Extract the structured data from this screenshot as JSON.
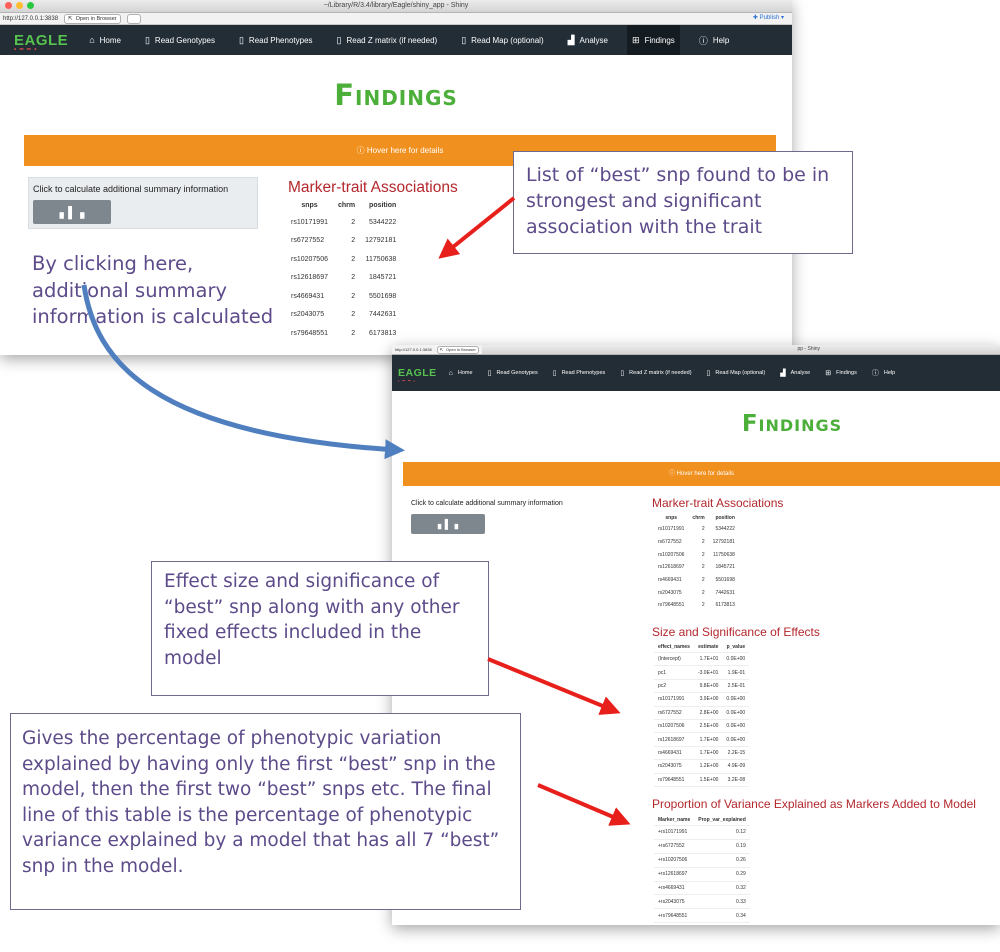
{
  "window1": {
    "titlebar": "~/Library/R/3.4/library/Eagle/shiny_app - Shiny",
    "url": "http://127.0.0.1:3838",
    "open_in_browser": "Open in Browser",
    "publish": "Publish",
    "logo": "EAGLE",
    "nav": {
      "home": "Home",
      "read_genotypes": "Read Genotypes",
      "read_phenotypes": "Read Phenotypes",
      "read_z": "Read Z matrix (if needed)",
      "read_map": "Read Map (optional)",
      "analyse": "Analyse",
      "findings": "Findings",
      "help": "Help"
    },
    "page_title": "Findings",
    "hover_text": "Hover here for details",
    "calc_text": "Click to calculate additional summary information",
    "assoc_title": "Marker-trait Associations",
    "assoc_headers": [
      "snps",
      "chrm",
      "position"
    ],
    "assoc_rows": [
      [
        "rs10171991",
        "2",
        "5344222"
      ],
      [
        "rs6727552",
        "2",
        "12792181"
      ],
      [
        "rs10207506",
        "2",
        "11750638"
      ],
      [
        "rs12618697",
        "2",
        "1845721"
      ],
      [
        "rs4669431",
        "2",
        "5501698"
      ],
      [
        "rs2043075",
        "2",
        "7442631"
      ],
      [
        "rs79648551",
        "2",
        "6173813"
      ]
    ]
  },
  "window2": {
    "titlebar": "pp - Shiny",
    "url": "http://127.0.0.1:3838",
    "open_in_browser": "Open in Browser",
    "logo": "EAGLE",
    "nav": {
      "home": "Home",
      "read_genotypes": "Read Genotypes",
      "read_phenotypes": "Read Phenotypes",
      "read_z": "Read Z matrix (if needed)",
      "read_map": "Read Map (optional)",
      "analyse": "Analyse",
      "findings": "Findings",
      "help": "Help"
    },
    "page_title": "Findings",
    "hover_text": "Hover here for details",
    "calc_text": "Click to calculate additional summary information",
    "assoc_title": "Marker-trait Associations",
    "assoc_headers": [
      "snps",
      "chrm",
      "position"
    ],
    "assoc_rows": [
      [
        "rs10171991",
        "2",
        "5344222"
      ],
      [
        "rs6727552",
        "2",
        "12792181"
      ],
      [
        "rs10207506",
        "2",
        "11750638"
      ],
      [
        "rs12618697",
        "2",
        "1845721"
      ],
      [
        "rs4669431",
        "2",
        "5501698"
      ],
      [
        "rs2043075",
        "2",
        "7442631"
      ],
      [
        "rs79648551",
        "2",
        "6173813"
      ]
    ],
    "effects_title": "Size and Significance of Effects",
    "effects_headers": [
      "effect_names",
      "estimate",
      "p_value"
    ],
    "effects_rows": [
      [
        "(Intercept)",
        "1.7E+01",
        "0.0E+00"
      ],
      [
        "pc1",
        "-3.0E+01",
        "1.9E-01"
      ],
      [
        "pc2",
        "9.8E+00",
        "2.5E-01"
      ],
      [
        "rs10171991",
        "3.9E+00",
        "0.0E+00"
      ],
      [
        "rs6727552",
        "2.8E+00",
        "0.0E+00"
      ],
      [
        "rs10207506",
        "2.5E+00",
        "0.0E+00"
      ],
      [
        "rs12618697",
        "1.7E+00",
        "0.0E+00"
      ],
      [
        "rs4669431",
        "1.7E+00",
        "2.2E-15"
      ],
      [
        "rs2043075",
        "1.2E+00",
        "4.9E-09"
      ],
      [
        "rs79648551",
        "1.5E+00",
        "3.2E-08"
      ]
    ],
    "variance_title": "Proportion of Variance Explained as Markers Added to Model",
    "variance_headers": [
      "Marker_name",
      "Prop_var_explained"
    ],
    "variance_rows": [
      [
        "+rs10171991",
        "0.12"
      ],
      [
        "+rs6727552",
        "0.19"
      ],
      [
        "+rs10207506",
        "0.26"
      ],
      [
        "+rs12618697",
        "0.29"
      ],
      [
        "+rs4669431",
        "0.32"
      ],
      [
        "+rs2043075",
        "0.33"
      ],
      [
        "+rs79648551",
        "0.34"
      ]
    ]
  },
  "annotations": {
    "best_snp_list": "List of “best” snp found to be in strongest and significant association with the trait",
    "click_here": "By clicking here, additional summary information is calculated",
    "effect_size": "Effect size and significance of “best” snp along with any other fixed effects included in the model",
    "variance": "Gives the percentage of phenotypic variation explained by having only the first “best” snp in the model, then the first two “best” snps etc. The final line of this table is  the percentage of phenotypic variance explained by a model that has all 7 “best” snp in the model."
  },
  "colors": {
    "navbar": "#222d36",
    "brand_green": "#4caf3a",
    "hover_bar": "#f0901e",
    "section_title": "#b3282d",
    "annotation_text": "#5d4b8a",
    "arrow_red": "#e8201c",
    "arrow_blue": "#4f7fbf"
  },
  "icons": {
    "home": "home-icon",
    "file": "file-icon",
    "analyse": "bar-chart-icon",
    "findings": "sitemap-icon",
    "help": "help-circle-icon",
    "calc": "bar-chart-icon"
  }
}
